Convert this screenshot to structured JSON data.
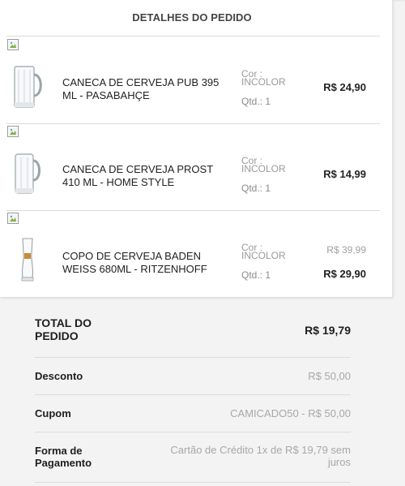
{
  "order_details": {
    "title": "DETALHES DO PEDIDO",
    "items": [
      {
        "name": "CANECA DE CERVEJA PUB 395 ML - PASABAHÇE",
        "color_label": "Cor :",
        "color_value": "INCOLOR",
        "quantity": "Qtd.: 1",
        "price": "R$ 24,90",
        "old_price": ""
      },
      {
        "name": "CANECA DE CERVEJA PROST 410 ML - HOME STYLE",
        "color_label": "Cor :",
        "color_value": "INCOLOR",
        "quantity": "Qtd.: 1",
        "price": "R$ 14,99",
        "old_price": ""
      },
      {
        "name": "COPO DE CERVEJA BADEN WEISS 680ML - RITZENHOFF",
        "color_label": "Cor :",
        "color_value": "INCOLOR",
        "quantity": "Qtd.: 1",
        "price": "R$ 29,90",
        "old_price": "R$ 39,99"
      }
    ]
  },
  "summary": {
    "total_label": "TOTAL DO PEDIDO",
    "total_value": "R$ 19,79",
    "discount_label": "Desconto",
    "discount_value": "R$ 50,00",
    "coupon_label": "Cupom",
    "coupon_value": "CAMICADO50 -  R$ 50,00",
    "payment_label": "Forma de Pagamento",
    "payment_value": "Cartão de Crédito 1x de R$ 19,79 sem juros"
  },
  "icons": {
    "broken_image": "broken-image-icon",
    "mug": "beer-mug-icon",
    "glass": "beer-glass-icon"
  },
  "colors": {
    "background": "#f3f3f3",
    "card": "#ffffff",
    "muted_text": "#a8a8a8"
  }
}
